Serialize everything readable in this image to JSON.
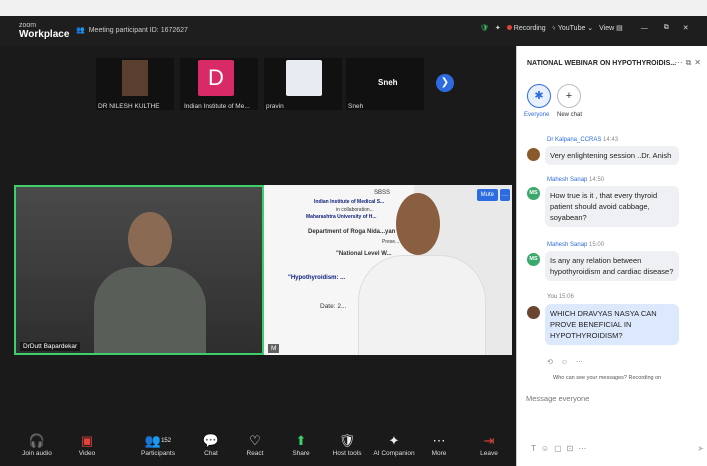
{
  "app": {
    "brand_small": "zoom",
    "brand_large": "Workplace",
    "meeting_id": "Meeting participant ID: 1672627"
  },
  "titlebar": {
    "recording": "Recording",
    "youtube": "YouTube",
    "view": "View"
  },
  "gallery": [
    {
      "name": "DR NILESH KULTHE"
    },
    {
      "name": "Indian Institute of Me...",
      "initial": "D"
    },
    {
      "name": "pravin"
    },
    {
      "name": "Sneh",
      "label_top": "Sneh"
    }
  ],
  "videos": {
    "left_name": "DrDutt Bapardekar",
    "right_name": "M",
    "mute_label": "Mute",
    "slide": {
      "header": "SBSS",
      "institute": "Indian Institute of Medical S...",
      "collab": "in collaboration...",
      "university": "Maharashtra University of H...",
      "dept": "Department of Roga Nida...yan",
      "presents": "Prese...",
      "national": "\"National Level W...",
      "topic": "\"Hypothyroidism: ...",
      "date": "Date: 2..."
    }
  },
  "controls": [
    {
      "label": "Join audio",
      "icon": "headphones-icon"
    },
    {
      "label": "Video",
      "icon": "video-off-icon"
    },
    {
      "label": "Participants",
      "icon": "participants-icon",
      "count": "152"
    },
    {
      "label": "Chat",
      "icon": "chat-icon"
    },
    {
      "label": "React",
      "icon": "heart-icon"
    },
    {
      "label": "Share",
      "icon": "share-icon"
    },
    {
      "label": "Host tools",
      "icon": "shield-icon"
    },
    {
      "label": "AI Companion",
      "icon": "sparkle-icon"
    },
    {
      "label": "More",
      "icon": "more-icon"
    },
    {
      "label": "Leave",
      "icon": "leave-icon"
    }
  ],
  "chat": {
    "title": "NATIONAL WEBINAR ON HYPOTHYROIDIS...",
    "tab_everyone": "Everyone",
    "tab_new": "New chat",
    "messages": [
      {
        "sender": "Dr Kalpana_CCRAS",
        "time": "14:43",
        "text": "Very enlightening session ..Dr. Anish"
      },
      {
        "sender": "Mahesh Sanap",
        "time": "14:50",
        "text": "How true is it , that every thyroid patient should avoid cabbage, soyabean?",
        "initials": "MS"
      },
      {
        "sender": "Mahesh Sanap",
        "time": "15:00",
        "text": "Is any any relation between hypothyroidism and cardiac disease?",
        "initials": "MS"
      },
      {
        "sender": "You",
        "time": "15:06",
        "text": "WHICH DRAVYAS NASYA CAN PROVE BENEFICIAL IN HYPOTHYROIDISM?"
      }
    ],
    "visibility_note": "Who can see your messages? Recording on",
    "placeholder": "Message everyone"
  },
  "colors": {
    "accent": "#2d6ce0",
    "active_speaker": "#3ecf6a",
    "avatar_d": "#d92a68",
    "ms_avatar": "#3aa86b"
  }
}
